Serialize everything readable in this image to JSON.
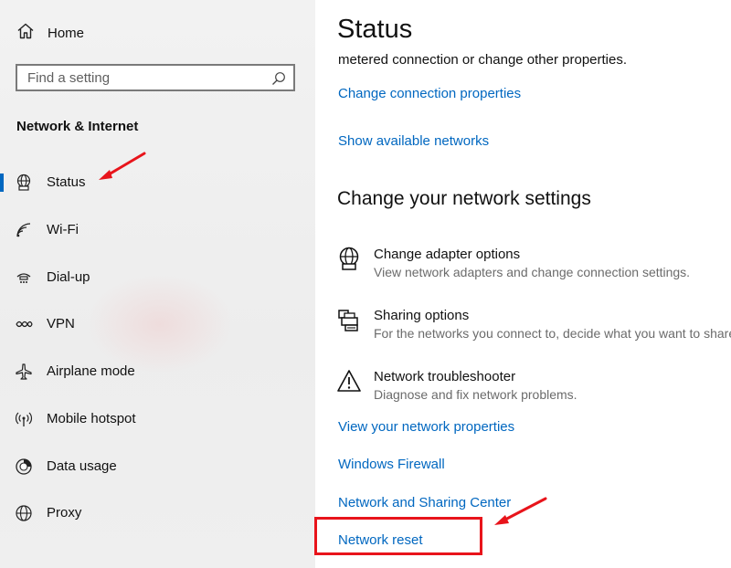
{
  "sidebar": {
    "home_label": "Home",
    "search_placeholder": "Find a setting",
    "section_title": "Network & Internet",
    "items": [
      {
        "label": "Status",
        "icon": "globe-monitor-icon",
        "active": true
      },
      {
        "label": "Wi-Fi",
        "icon": "wifi-icon"
      },
      {
        "label": "Dial-up",
        "icon": "dial-up-icon"
      },
      {
        "label": "VPN",
        "icon": "vpn-icon"
      },
      {
        "label": "Airplane mode",
        "icon": "airplane-icon"
      },
      {
        "label": "Mobile hotspot",
        "icon": "hotspot-icon"
      },
      {
        "label": "Data usage",
        "icon": "data-usage-icon"
      },
      {
        "label": "Proxy",
        "icon": "globe-icon"
      }
    ]
  },
  "main": {
    "title": "Status",
    "description_fragment": "metered connection or change other properties.",
    "links_top": [
      "Change connection properties",
      "Show available networks"
    ],
    "section_title": "Change your network settings",
    "options": [
      {
        "title": "Change adapter options",
        "description": "View network adapters and change connection settings.",
        "icon": "globe-monitor-icon"
      },
      {
        "title": "Sharing options",
        "description": "For the networks you connect to, decide what you want to share.",
        "icon": "sharing-printer-icon"
      },
      {
        "title": "Network troubleshooter",
        "description": "Diagnose and fix network problems.",
        "icon": "warning-icon"
      }
    ],
    "links_bottom": [
      "View your network properties",
      "Windows Firewall",
      "Network and Sharing Center",
      "Network reset"
    ]
  },
  "colors": {
    "accent": "#0067c0",
    "annotation": "#e8141b",
    "sidebar_bg": "#f2f2f2"
  }
}
